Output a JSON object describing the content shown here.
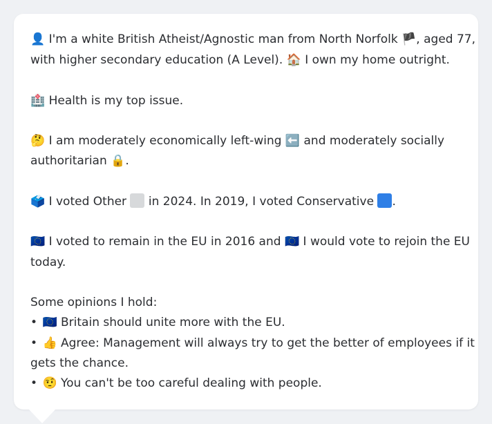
{
  "profile": {
    "line1": {
      "icon": "👤",
      "text_a": "I'm a white British Atheist/Agnostic man from North Norfolk",
      "flag": "🏴",
      "text_b": ", aged 77,"
    },
    "line2": {
      "text_a": "with higher secondary education (A Level).",
      "house_icon": "🏠",
      "text_b": "I own my home outright."
    },
    "health": {
      "icon": "🏥",
      "text": "Health is my top issue."
    },
    "econ": {
      "icon": "🤔",
      "text_a": "I am moderately economically left-wing",
      "arrow_icon": "⬅️",
      "text_b": "and moderately socially"
    },
    "econ2": {
      "text": "authoritarian",
      "lock_icon": "🔒",
      "tail": "."
    },
    "vote": {
      "icon": "🗳️",
      "text_a": "I voted Other",
      "text_b": "in 2024. In 2019, I voted Conservative",
      "tail": ".",
      "other_color": "#d7d9db",
      "conservative_color": "#2f7fe6"
    },
    "eu": {
      "icon": "🇪🇺",
      "text_a": "I voted to remain in the EU in 2016 and",
      "text_b": "I would vote to rejoin the EU",
      "text_c": "today."
    },
    "opinions": {
      "heading": "Some opinions I hold:",
      "bullet": "•",
      "items": [
        {
          "icon": "🇪🇺",
          "text": "Britain should unite more with the EU."
        },
        {
          "icon": "👍",
          "text": "Agree: Management will always try to get the better of employees if it",
          "cont": "gets the chance."
        },
        {
          "icon": "🤨",
          "text": "You can't be too careful dealing with people."
        }
      ]
    }
  }
}
